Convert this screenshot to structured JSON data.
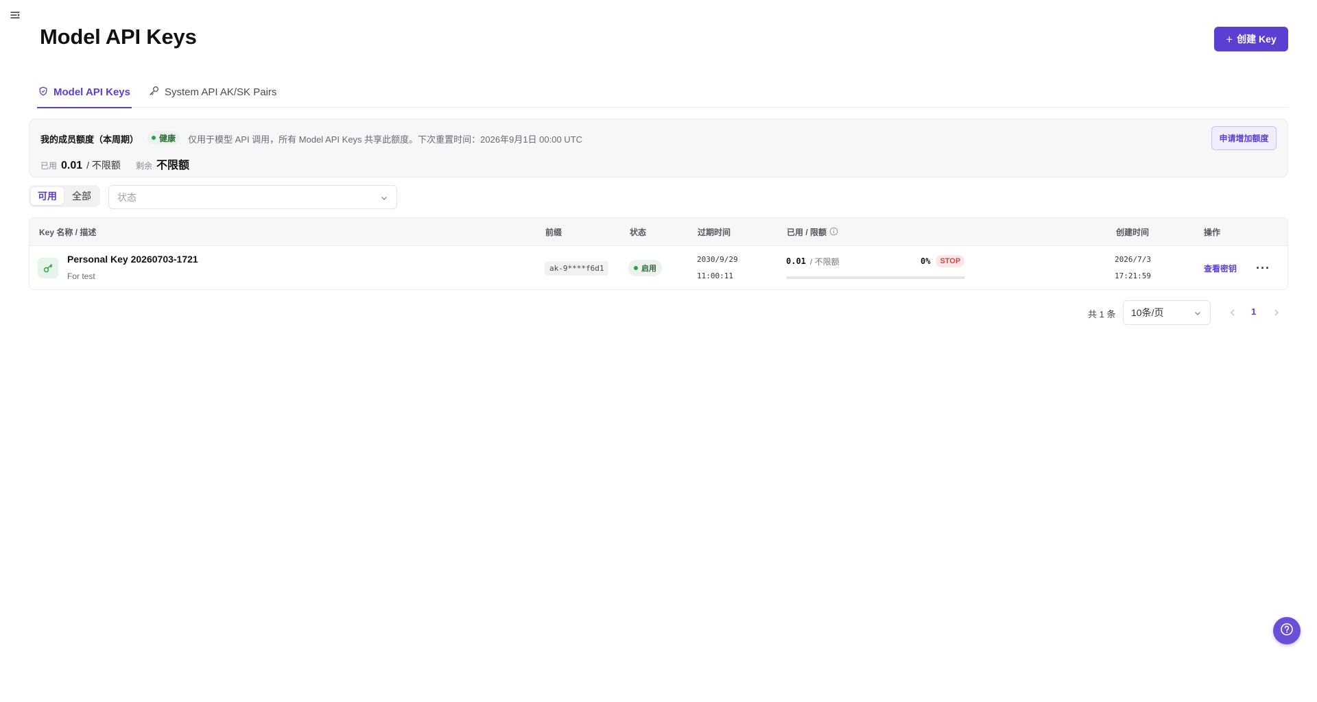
{
  "page": {
    "title": "Model API Keys"
  },
  "header": {
    "create_button": "创建 Key",
    "create_icon": "plus-icon"
  },
  "tabs": [
    {
      "label": "Model API Keys",
      "icon": "shield-icon",
      "active": true
    },
    {
      "label": "System API AK/SK Pairs",
      "icon": "key-icon",
      "active": false
    }
  ],
  "quota": {
    "title": "我的成员额度（本周期）",
    "health_badge": "健康",
    "note": "仅用于模型 API 调用，所有 Model API Keys 共享此额度。下次重置时间：2026年9月1日 00:00 UTC",
    "used_label": "已用",
    "used_value": "0.01",
    "limit_text": "/ 不限额",
    "remaining_label": "剩余",
    "remaining_value": "不限额",
    "apply_button": "申请增加额度"
  },
  "filter": {
    "segments": [
      "可用",
      "全部"
    ],
    "active_segment": "可用",
    "status_placeholder": "状态"
  },
  "table": {
    "headers": {
      "name": "Key 名称 / 描述",
      "prefix": "前缀",
      "status": "状态",
      "expires": "过期时间",
      "usage": "已用 / 限额",
      "created": "创建时间",
      "actions": "操作"
    },
    "rows": [
      {
        "name": "Personal Key 20260703-1721",
        "description": "For test",
        "prefix": "ak-9****f6d1",
        "status": "启用",
        "expires_date": "2030/9/29",
        "expires_time": "11:00:11",
        "used": "0.01",
        "limit": "/ 不限额",
        "percent": "0%",
        "progress": 0.0,
        "stop_badge": "STOP",
        "created_date": "2026/7/3",
        "created_time": "17:21:59",
        "action_view": "查看密钥",
        "action_more": "···"
      }
    ]
  },
  "pagination": {
    "total": "共 1 条",
    "page_size": "10条/页",
    "current_page": "1"
  },
  "colors": {
    "accent": "#5b3fd0",
    "success": "#22a545",
    "danger": "#d04545"
  }
}
